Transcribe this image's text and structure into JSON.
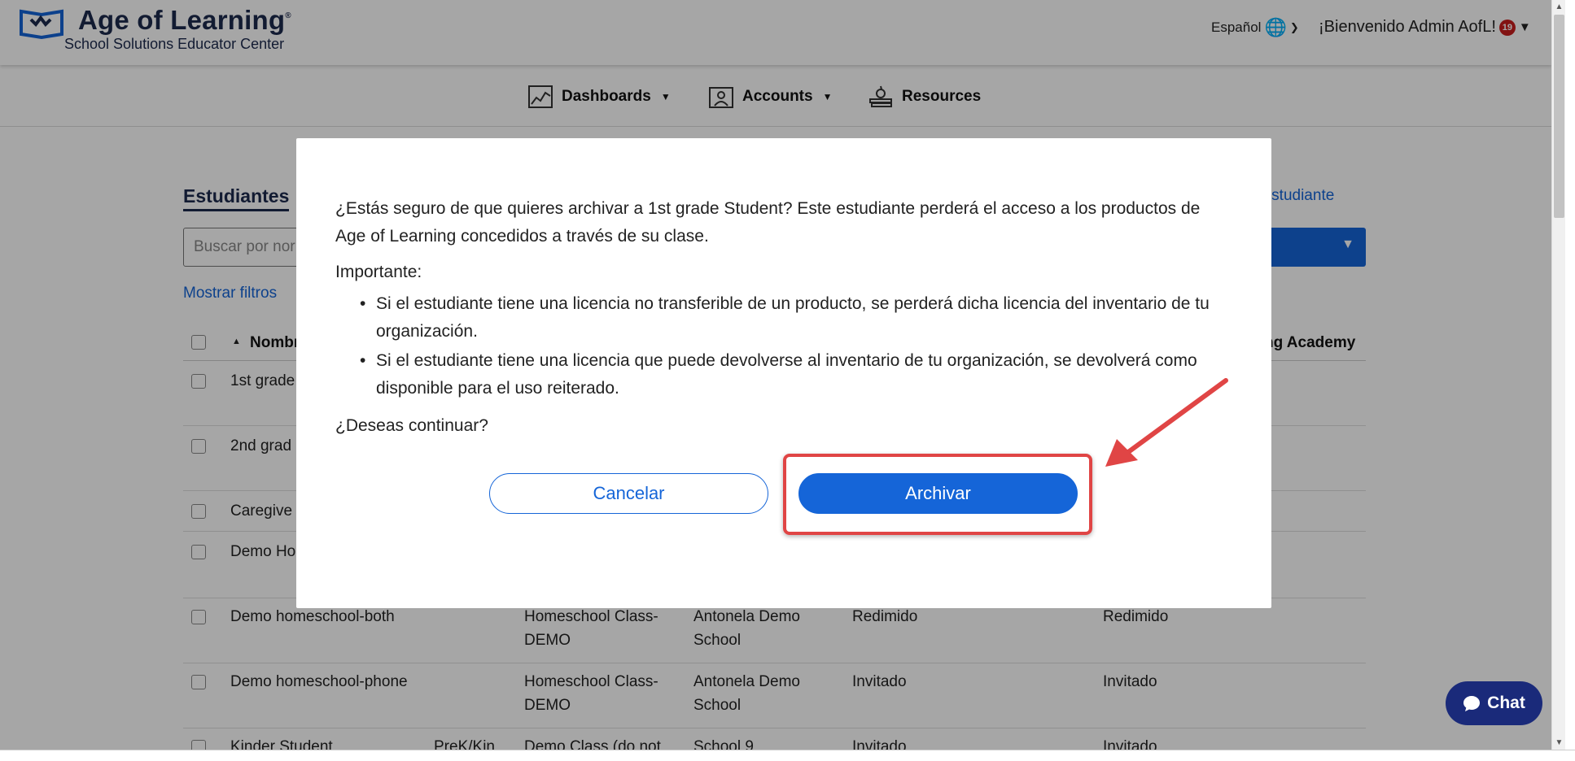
{
  "header": {
    "brand": "Age of Learning",
    "trademark": "®",
    "subbrand": "School Solutions Educator Center",
    "language_label": "Español",
    "welcome_text": "¡Bienvenido Admin AofL!",
    "notification_count": "19"
  },
  "nav": {
    "items": [
      {
        "label": "Dashboards",
        "icon": "chart-icon"
      },
      {
        "label": "Accounts",
        "icon": "user-board-icon"
      },
      {
        "label": "Resources",
        "icon": "books-icon"
      }
    ]
  },
  "page": {
    "section_title": "Estudiantes",
    "add_student_link": "r estudiante",
    "search_placeholder": "Buscar por nor",
    "show_filters": "Mostrar filtros",
    "col_name": "Nombr",
    "col_academy": "ng Academy"
  },
  "table": {
    "rows": [
      {
        "name": "1st grade",
        "grade": "",
        "class": "",
        "school": "",
        "status1": "",
        "status2": ""
      },
      {
        "name": "2nd grad",
        "grade": "",
        "class": "",
        "school": "",
        "status1": "",
        "status2": ""
      },
      {
        "name": "Caregive",
        "grade": "",
        "class": "",
        "school": "",
        "status1": "",
        "status2": ""
      },
      {
        "name": "Demo Ho",
        "grade": "",
        "class": "",
        "school": "",
        "status1": "",
        "status2": ""
      },
      {
        "name": "Demo homeschool-both",
        "grade": "",
        "class_line1": "Homeschool Class-",
        "class_line2": "DEMO",
        "school_line1": "Antonela Demo",
        "school_line2": "School",
        "status1": "Redimido",
        "status2": "Redimido"
      },
      {
        "name": "Demo homeschool-phone",
        "grade": "",
        "class_line1": "Homeschool Class-",
        "class_line2": "DEMO",
        "school_line1": "Antonela Demo",
        "school_line2": "School",
        "status1": "Invitado",
        "status2": "Invitado"
      },
      {
        "name": "Kinder Student",
        "grade": "PreK/Kin",
        "class_line1": "Demo Class (do not",
        "class_line2": "",
        "school_line1": "School 9",
        "school_line2": "",
        "status1": "Invitado",
        "status2": "Invitado"
      }
    ]
  },
  "modal": {
    "question": "¿Estás seguro de que quieres archivar a 1st grade Student? Este estudiante perderá el acceso a los productos de Age of Learning concedidos a través de su clase.",
    "important_label": "Importante:",
    "bullets": [
      "Si el estudiante tiene una licencia no transferible de un producto, se perderá dicha licencia del inventario de tu organización.",
      "Si el estudiante tiene una licencia que puede devolverse al inventario de tu organización, se devolverá como disponible para el uso reiterado."
    ],
    "continue_question": "¿Deseas continuar?",
    "cancel_label": "Cancelar",
    "archive_label": "Archivar"
  },
  "chat": {
    "label": "Chat"
  },
  "colors": {
    "primary_blue": "#1565d8",
    "brand_navy": "#1d2a4e",
    "highlight_red": "#e04545",
    "chat_navy": "#1a2a7a",
    "badge_red": "#c81e1e"
  }
}
